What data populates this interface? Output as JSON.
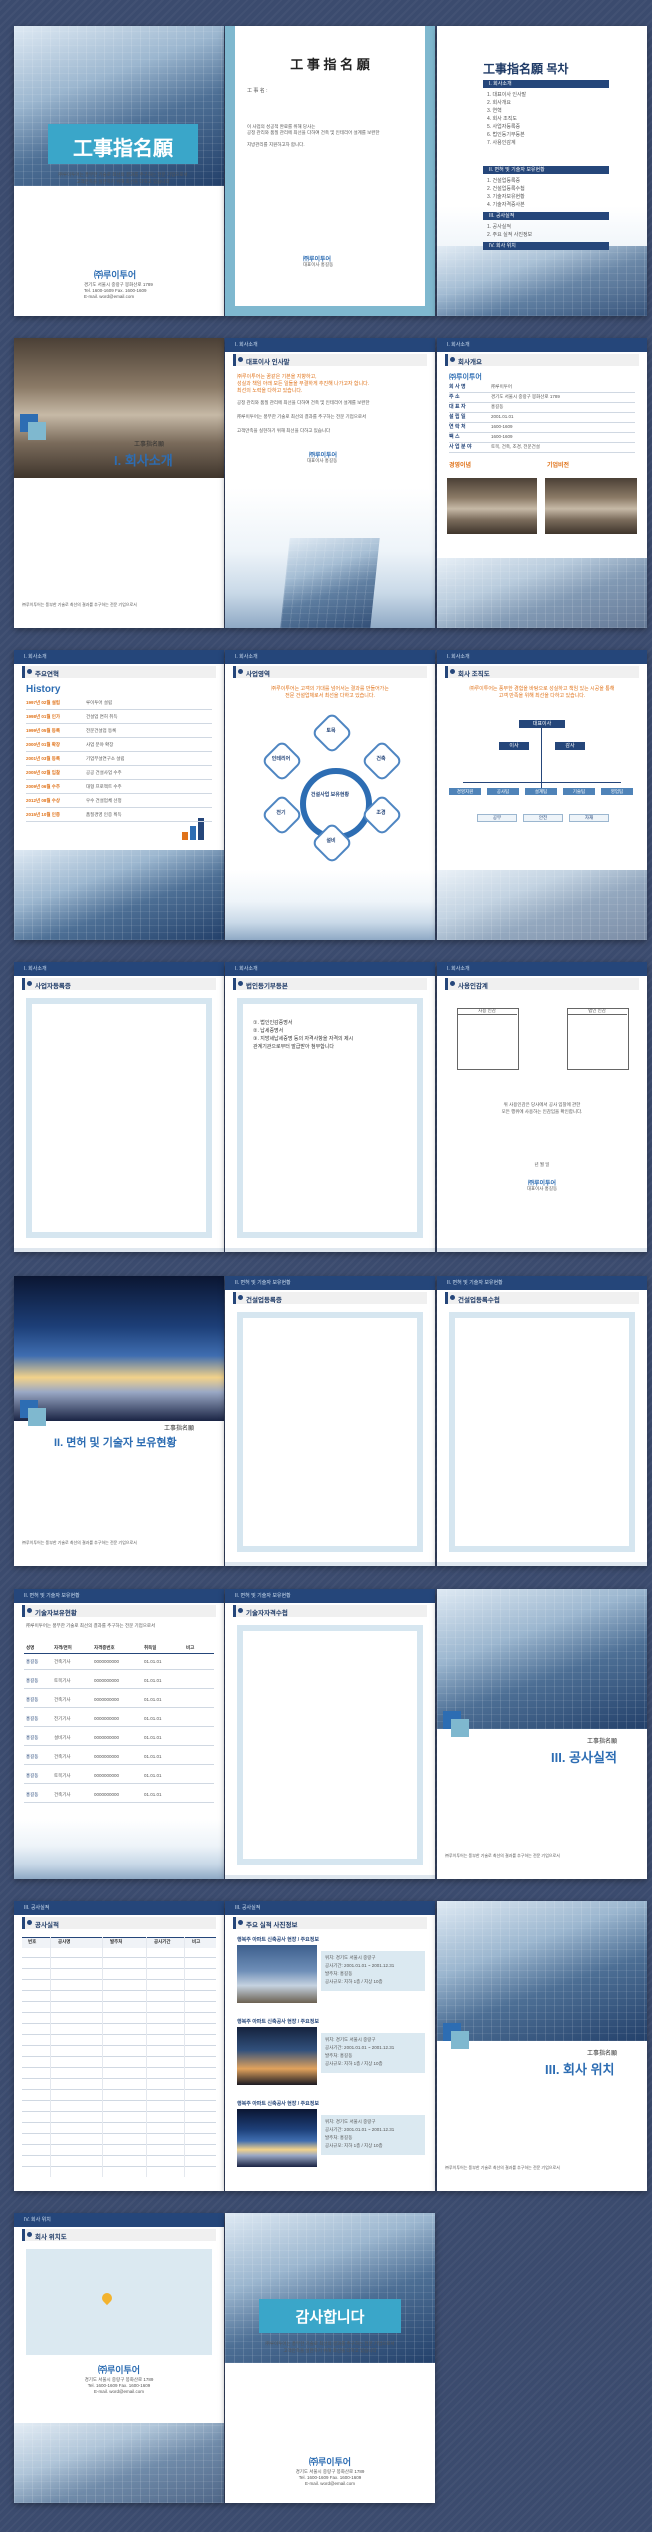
{
  "cover": {
    "title": "工事指名願",
    "sub1": "㈜루이투어는 풍부한 기술로 최선의 결과를 추구하는 전문 기업으로서",
    "sub2": "고객만족을 실현하기 위해 최선을 다하고 있습니다",
    "company": "㈜루이투어",
    "addr1": "경기도 서울시 중랑구 봉화산로 1789",
    "addr2": "Tel. 1600-1609  Fax. 1600-1609",
    "addr3": "E-mail. word@email.com"
  },
  "letter": {
    "title": "工 事 指 名 願",
    "to": "工 事 名 :",
    "body1": "이 사업의 성공적 완료를 위해 당사는",
    "body2": "공정 관리와 품질 관리에 최선을 다하여 건축 및 인테리어 설계를 보완한",
    "body3": "지방관리를 지원하고자 합니다.",
    "footer": "㈜루이투어",
    "footer2": "대표이사 홍길동"
  },
  "toc": {
    "title": "工事指名願 목차",
    "s1": "I. 회사소개",
    "s1items": [
      "1. 대표이사 인사말",
      "2. 회사개요",
      "3. 연혁",
      "4. 회사 조직도",
      "5. 사업자등록증",
      "6. 법인등기부등본",
      "7. 사용인감계"
    ],
    "s2": "II. 면허 및 기술자 보유현황",
    "s2items": [
      "1. 건설업등록증",
      "2. 건설업등록수첩",
      "3. 기술자보유현황",
      "4. 기술자격증사본"
    ],
    "s3": "III. 공사실적",
    "s3items": [
      "1. 공사실적",
      "2. 주요 실적 사진정보"
    ],
    "s4": "IV. 회사 위치"
  },
  "section1": {
    "label": "工事指名願",
    "title": "I. 회사소개"
  },
  "section2": {
    "label": "工事指名願",
    "title": "II. 면허 및 기술자 보유현황"
  },
  "section3": {
    "label": "工事指名願",
    "title": "III. 공사실적"
  },
  "section4": {
    "label": "工事指名願",
    "title": "III. 회사 위치"
  },
  "greeting": {
    "crumb": "I. 회사소개",
    "title": "대표이사 인사말",
    "lead1": "㈜루이투어는 꿈같은 기본을 지향하고,",
    "lead2": "성실과 책임 아래 모든 일들을 무결하게 추진해 나가고자 합니다.",
    "lead3": "최선의 노력을 다하고 있습니다.",
    "sign1": "㈜루이투어",
    "sign2": "대표이사 홍길동"
  },
  "overview": {
    "crumb": "I. 회사소개",
    "title": "회사개요",
    "company": "㈜루이투어",
    "rows": [
      {
        "k": "회 사 명",
        "v": "㈜루이투어"
      },
      {
        "k": "주 소",
        "v": "경기도 서울시 중랑구 봉화산로 1789"
      },
      {
        "k": "대 표 자",
        "v": "홍길동"
      },
      {
        "k": "설 립 일",
        "v": "2001.01.01"
      },
      {
        "k": "연 락 처",
        "v": "1600-1609"
      },
      {
        "k": "팩 스",
        "v": "1600-1609"
      },
      {
        "k": "사 업 분 야",
        "v": "토목, 건축, 조경, 전문건설"
      }
    ],
    "h1": "경영이념",
    "h2": "기업비전"
  },
  "history": {
    "crumb": "I. 회사소개",
    "title": "주요연혁",
    "label": "History",
    "rows": [
      {
        "y": "1997년 02월 설립",
        "t": "루이투어 설립"
      },
      {
        "y": "1998년 01월 인가",
        "t": "건설업 면허 취득"
      },
      {
        "y": "1999년 05월 등록",
        "t": "전문건설업 등록"
      },
      {
        "y": "2000년 01월 확장",
        "t": "사업 분야 확장"
      },
      {
        "y": "2001년 03월 등록",
        "t": "기업부설연구소 설립"
      },
      {
        "y": "2005년 02월 입찰",
        "t": "공공 건설사업 수주"
      },
      {
        "y": "2009년 06월 수주",
        "t": "대형 프로젝트 수주"
      },
      {
        "y": "2012년 08월 수상",
        "t": "우수 건설업체 선정"
      },
      {
        "y": "2015년 10월 인증",
        "t": "품질경영 인증 획득"
      }
    ]
  },
  "business": {
    "crumb": "I. 회사소개",
    "title": "사업영역",
    "lead1": "㈜루이투어는 고객의 기대를 넘어서는 결과를 만들어가는",
    "lead2": "전문 건설업체로서 최선을 다하고 있습니다.",
    "center": "건설사업 보유현황",
    "hx": [
      "토목",
      "건축",
      "조경",
      "설비",
      "전기",
      "인테리어"
    ]
  },
  "org": {
    "crumb": "I. 회사소개",
    "title": "회사 조직도",
    "lead1": "㈜루이투어는 풍부한 경험을 바탕으로 성실하고 책임 있는 시공을 통해",
    "lead2": "고객 만족을 위해 최선을 다하고 있습니다.",
    "top": "대표이사",
    "mid": [
      "이사",
      "감사"
    ],
    "depts": [
      "경영지원",
      "공사팀",
      "설계팀",
      "기술팀",
      "영업팀"
    ],
    "subs": [
      "공무",
      "안전",
      "자재"
    ]
  },
  "biz_reg": {
    "crumb": "I. 회사소개",
    "title": "사업자등록증"
  },
  "corp_reg": {
    "crumb": "I. 회사소개",
    "title": "법인등기부등본",
    "lines": [
      "①. 법인인감증명서",
      "②. 납세증명서",
      "③. 지방세납세증명 등의 자격사항을 자격의 제시",
      "관계기관으로부터 발급받아 첨부합니다"
    ]
  },
  "seal": {
    "crumb": "I. 회사소개",
    "title": "사용인감계",
    "box1": "사용 인감",
    "box2": "법인 인감",
    "body1": "위 사용인감은 당사에서 공사 입찰에 관한",
    "body2": "모든 행위에 사용하는 인감임을 확인합니다.",
    "date": "년    월    일",
    "sign1": "㈜루이투어",
    "sign2": "대표이사 홍길동"
  },
  "cons_reg": {
    "crumb": "II. 면허 및 기술자 보유현황",
    "title": "건설업등록증"
  },
  "cons_book": {
    "crumb": "II. 면허 및 기술자 보유현황",
    "title": "건설업등록수첩"
  },
  "tech": {
    "crumb": "II. 면허 및 기술자 보유현황",
    "title": "기술자보유현황",
    "headers": [
      "성명",
      "자격/면허",
      "자격증번호",
      "취득일",
      "비고"
    ],
    "rows": [
      [
        "홍길동",
        "건축기사",
        "0000000000",
        "01.01.01",
        ""
      ],
      [
        "홍길동",
        "토목기사",
        "0000000000",
        "01.01.01",
        ""
      ],
      [
        "홍길동",
        "건축기사",
        "0000000000",
        "01.01.01",
        ""
      ],
      [
        "홍길동",
        "전기기사",
        "0000000000",
        "01.01.01",
        ""
      ],
      [
        "홍길동",
        "설비기사",
        "0000000000",
        "01.01.01",
        ""
      ],
      [
        "홍길동",
        "건축기사",
        "0000000000",
        "01.01.01",
        ""
      ],
      [
        "홍길동",
        "토목기사",
        "0000000000",
        "01.01.01",
        ""
      ],
      [
        "홍길동",
        "건축기사",
        "0000000000",
        "01.01.01",
        ""
      ]
    ]
  },
  "cert": {
    "crumb": "II. 면허 및 기술자 보유현황",
    "title": "기술자자격수첩"
  },
  "records": {
    "crumb": "III. 공사실적",
    "title": "공사실적",
    "headers": [
      "번호",
      "공사명",
      "발주처",
      "공사기간",
      "비고"
    ]
  },
  "photos": {
    "crumb": "III. 공사실적",
    "title": "주요 실적 사진정보",
    "items": [
      "행복주 아파트 신축공사 현장 / 주요정보",
      "행복주 아파트 신축공사 현장 / 주요정보",
      "행복주 아파트 신축공사 현장 / 주요정보"
    ],
    "info": [
      "위치: 경기도 서울시 중랑구",
      "공사기간: 2001.01.01 ~ 2001.12.31",
      "발주처: 홍길동",
      "공사규모: 지하 1층 / 지상 10층"
    ]
  },
  "location": {
    "crumb": "IV. 회사 위치",
    "title": "회사 위치도",
    "company": "㈜루이투어",
    "addr1": "경기도 서울시 중랑구 봉화산로 1789",
    "addr2": "Tel. 1600-1609  Fax. 1600-1609",
    "addr3": "E-mail. word@email.com"
  },
  "thanks": {
    "title": "감사합니다",
    "sub1": "㈜루이투어는 풍부한 기술로 최선의 결과를 추구하는 전문 기업으로서",
    "sub2": "고객만족을 실현하기 위해 최선을 다하고 있습니다",
    "company": "㈜루이투어",
    "addr1": "경기도 서울시 중랑구 봉화산로 1789",
    "addr2": "Tel. 1600-1609  Fax. 1600-1609",
    "addr3": "E-mail. word@email.com"
  }
}
